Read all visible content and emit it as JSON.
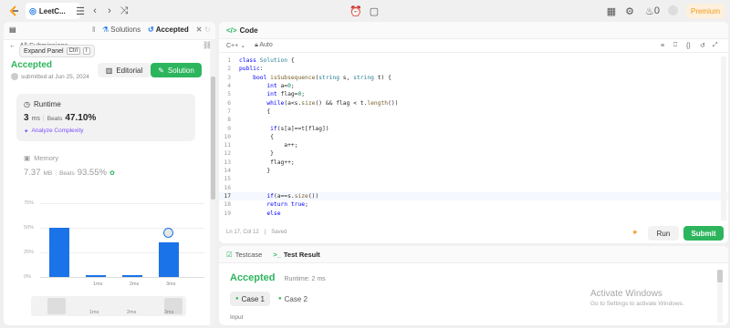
{
  "topbar": {
    "tab_title": "LeetC...",
    "premium": "Premium",
    "coins": "0"
  },
  "tooltip": {
    "label": "Expand Panel",
    "key1": "Ctrl",
    "key2": "I"
  },
  "left_tabs": {
    "solutions": "Solutions",
    "accepted": "Accepted"
  },
  "submission": {
    "back_label": "All Submissions",
    "status": "Accepted",
    "submitted": "submitted at Jun 25, 2024",
    "editorial": "Editorial",
    "solution": "Solution"
  },
  "runtime": {
    "title": "Runtime",
    "value": "3",
    "unit": "ms",
    "beats_label": "Beats",
    "beats_value": "47.10%",
    "analyze": "Analyze Complexity"
  },
  "memory": {
    "title": "Memory",
    "value": "7.37",
    "unit": "MB",
    "beats_label": "Beats",
    "beats_value": "93.55%"
  },
  "chart_data": {
    "type": "bar",
    "y_tick_labels": [
      "75%",
      "50%",
      "25%",
      "0%"
    ],
    "bar_values": [
      50,
      2,
      2,
      35
    ],
    "x_tick_labels": [
      "1ms",
      "2ms",
      "3ms"
    ],
    "bottom_labels": [
      "1ms",
      "2ms",
      "3ms"
    ],
    "highlight_index": 3,
    "ylim": [
      0,
      75
    ],
    "color": "#1a73e8"
  },
  "code_panel": {
    "title": "Code",
    "language": "C++",
    "mode": "Auto",
    "status": "Ln 17, Col 12",
    "saved": "Saved",
    "run": "Run",
    "submit": "Submit"
  },
  "code_lines": [
    {
      "n": "1",
      "html": "<span class='kw'>class</span> <span class='ty'>Solution</span> {"
    },
    {
      "n": "2",
      "html": "<span class='kw'>public</span>:"
    },
    {
      "n": "3",
      "html": "&nbsp;&nbsp;&nbsp;&nbsp;<span class='kw'>bool</span> <span class='fn'>isSubsequence</span>(<span class='ty'>string</span> s, <span class='ty'>string</span> t) {"
    },
    {
      "n": "4",
      "html": "&nbsp;&nbsp;&nbsp;&nbsp;&nbsp;&nbsp;&nbsp;&nbsp;<span class='kw'>int</span> a=<span class='nu'>0</span>;"
    },
    {
      "n": "5",
      "html": "&nbsp;&nbsp;&nbsp;&nbsp;&nbsp;&nbsp;&nbsp;&nbsp;<span class='kw'>int</span> flag=<span class='nu'>0</span>;"
    },
    {
      "n": "6",
      "html": "&nbsp;&nbsp;&nbsp;&nbsp;&nbsp;&nbsp;&nbsp;&nbsp;<span class='kw'>while</span>(a&lt;s.<span class='fn'>size</span>() &amp;&amp; flag &lt; t.<span class='fn'>length</span>())"
    },
    {
      "n": "7",
      "html": "&nbsp;&nbsp;&nbsp;&nbsp;&nbsp;&nbsp;&nbsp;&nbsp;{"
    },
    {
      "n": "8",
      "html": ""
    },
    {
      "n": "9",
      "html": "&nbsp;&nbsp;&nbsp;&nbsp;&nbsp;&nbsp;&nbsp;&nbsp;&nbsp;<span class='kw'>if</span>(s[a]==t[flag])"
    },
    {
      "n": "10",
      "html": "&nbsp;&nbsp;&nbsp;&nbsp;&nbsp;&nbsp;&nbsp;&nbsp;&nbsp;{"
    },
    {
      "n": "11",
      "html": "&nbsp;&nbsp;&nbsp;&nbsp;&nbsp;&nbsp;&nbsp;&nbsp;&nbsp;&nbsp;&nbsp;&nbsp;&nbsp;a++;"
    },
    {
      "n": "12",
      "html": "&nbsp;&nbsp;&nbsp;&nbsp;&nbsp;&nbsp;&nbsp;&nbsp;&nbsp;}"
    },
    {
      "n": "13",
      "html": "&nbsp;&nbsp;&nbsp;&nbsp;&nbsp;&nbsp;&nbsp;&nbsp;&nbsp;flag++;"
    },
    {
      "n": "14",
      "html": "&nbsp;&nbsp;&nbsp;&nbsp;&nbsp;&nbsp;&nbsp;&nbsp;}"
    },
    {
      "n": "15",
      "html": ""
    },
    {
      "n": "16",
      "html": ""
    },
    {
      "n": "17",
      "html": "&nbsp;&nbsp;&nbsp;&nbsp;&nbsp;&nbsp;&nbsp;&nbsp;<span class='kw'>if</span>(a==s.<span class='fn'>size</span>())"
    },
    {
      "n": "18",
      "html": "&nbsp;&nbsp;&nbsp;&nbsp;&nbsp;&nbsp;&nbsp;&nbsp;<span class='kw'>return</span> <span class='kw'>true</span>;"
    },
    {
      "n": "19",
      "html": "&nbsp;&nbsp;&nbsp;&nbsp;&nbsp;&nbsp;&nbsp;&nbsp;<span class='kw'>else</span>"
    }
  ],
  "result_panel": {
    "testcase_tab": "Testcase",
    "result_tab": "Test Result",
    "status": "Accepted",
    "runtime": "Runtime: 2 ms",
    "case1": "Case 1",
    "case2": "Case 2",
    "input_label": "Input"
  },
  "watermark": {
    "title": "Activate Windows",
    "subtitle": "Go to Settings to activate Windows."
  },
  "colors": {
    "accent_green": "#2db55d",
    "bar_blue": "#1a73e8",
    "premium_orange": "#f29b1d"
  }
}
